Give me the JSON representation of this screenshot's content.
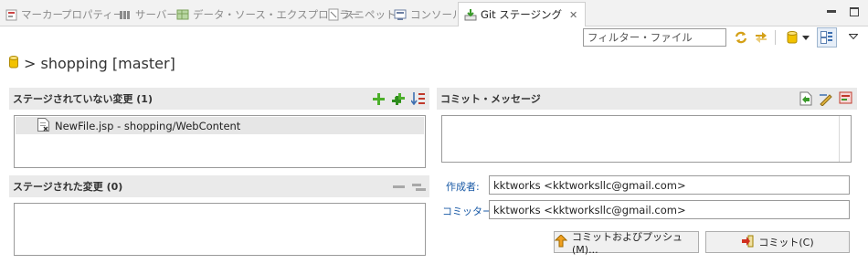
{
  "tabs": [
    {
      "label": "マーカー",
      "icon": "markers-icon"
    },
    {
      "label": "プロパティー",
      "icon": "properties-icon"
    },
    {
      "label": "サーバー",
      "icon": "servers-icon"
    },
    {
      "label": "データ・ソース・エクスプローラー",
      "icon": "data-source-icon"
    },
    {
      "label": "スニペット",
      "icon": "snippets-icon"
    },
    {
      "label": "コンソール",
      "icon": "console-icon"
    },
    {
      "label": "Git ステージング",
      "icon": "git-staging-icon",
      "active": true
    }
  ],
  "filter": {
    "placeholder": "フィルター・ファイル"
  },
  "repo": {
    "title": "> shopping [master]"
  },
  "unstaged": {
    "title": "ステージされていない変更 (1)",
    "files": [
      {
        "label": "NewFile.jsp - shopping/WebContent"
      }
    ]
  },
  "staged": {
    "title": "ステージされた変更 (0)"
  },
  "commit": {
    "title": "コミット・メッセージ",
    "message": "",
    "author_label": "作成者:",
    "author_value": "kktworks <kktworksllc@gmail.com>",
    "committer_label": "コミッター:",
    "committer_value": "kktworks <kktworksllc@gmail.com>",
    "commit_push_label": "コミットおよびプッシュ(M)...",
    "commit_label": "コミット(C)"
  },
  "colors": {
    "accent_green": "#4caf2a",
    "label_blue": "#1a5aa6",
    "repo_yellow": "#e8b820"
  }
}
